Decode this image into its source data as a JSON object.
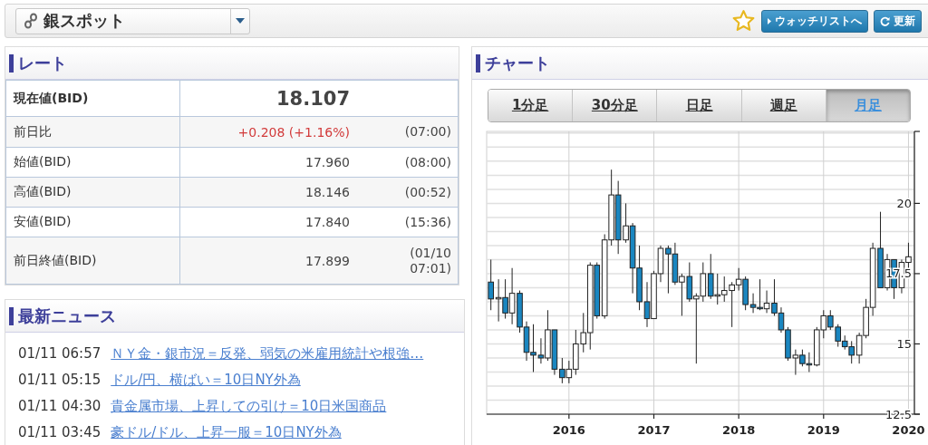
{
  "header": {
    "instrument": "銀スポット",
    "favorite": false,
    "watchlist_button": "ウォッチリストへ",
    "refresh_button": "更新"
  },
  "rate": {
    "title": "レート",
    "rows": [
      {
        "kind": "main",
        "label": "現在値(BID)",
        "value": "18.107"
      },
      {
        "kind": "change",
        "label": "前日比",
        "value": "+0.208 (+1.16%)",
        "time": "(07:00)"
      },
      {
        "kind": "plain",
        "label": "始値(BID)",
        "value": "17.960",
        "time": "(08:00)"
      },
      {
        "kind": "plain",
        "label": "高値(BID)",
        "value": "18.146",
        "time": "(00:52)"
      },
      {
        "kind": "plain",
        "label": "安値(BID)",
        "value": "17.840",
        "time": "(15:36)"
      },
      {
        "kind": "plain",
        "label": "前日終値(BID)",
        "value": "17.899",
        "time": "(01/10 07:01)"
      }
    ]
  },
  "news": {
    "title": "最新ニュース",
    "items": [
      {
        "time": "01/11 06:57",
        "headline": "ＮＹ金・銀市況＝反発、弱気の米雇用統計や根強…"
      },
      {
        "time": "01/11 05:15",
        "headline": "ドル/円、横ばい＝10日NY外為"
      },
      {
        "time": "01/11 04:30",
        "headline": "貴金属市場、上昇しての引け＝10日米国商品"
      },
      {
        "time": "01/11 03:45",
        "headline": "豪ドル/ドル、上昇一服＝10日NY外為"
      }
    ]
  },
  "chart": {
    "title": "チャート",
    "tabs": [
      {
        "label": "1分足",
        "selected": false
      },
      {
        "label": "30分足",
        "selected": false
      },
      {
        "label": "日足",
        "selected": false
      },
      {
        "label": "週足",
        "selected": false
      },
      {
        "label": "月足",
        "selected": true
      }
    ],
    "chart_data": {
      "type": "candlestick",
      "xlim": [
        2015.03,
        2020.07
      ],
      "ylim": [
        12.5,
        22.56
      ],
      "xticks": [
        {
          "value": 2016,
          "label": "2016"
        },
        {
          "value": 2017,
          "label": "2017"
        },
        {
          "value": 2018,
          "label": "2018"
        },
        {
          "value": 2019,
          "label": "2019"
        },
        {
          "value": 2020,
          "label": "2020"
        }
      ],
      "yticks": [
        12.5,
        15,
        17.5,
        20
      ],
      "grid": true,
      "x": [
        2015.08,
        2015.17,
        2015.25,
        2015.33,
        2015.42,
        2015.5,
        2015.58,
        2015.67,
        2015.75,
        2015.83,
        2015.92,
        2016.0,
        2016.08,
        2016.17,
        2016.25,
        2016.33,
        2016.42,
        2016.5,
        2016.58,
        2016.67,
        2016.75,
        2016.83,
        2016.92,
        2017.0,
        2017.08,
        2017.17,
        2017.25,
        2017.33,
        2017.42,
        2017.5,
        2017.58,
        2017.67,
        2017.75,
        2017.83,
        2017.92,
        2018.0,
        2018.08,
        2018.17,
        2018.25,
        2018.33,
        2018.42,
        2018.5,
        2018.58,
        2018.67,
        2018.75,
        2018.83,
        2018.92,
        2019.0,
        2019.08,
        2019.17,
        2019.25,
        2019.33,
        2019.42,
        2019.5,
        2019.58,
        2019.67,
        2019.75,
        2019.83,
        2019.92,
        2020.0
      ],
      "ohlc": [
        [
          17.2,
          18.0,
          16.2,
          16.6
        ],
        [
          16.6,
          17.3,
          15.8,
          16.65
        ],
        [
          16.65,
          17.3,
          15.9,
          16.1
        ],
        [
          16.1,
          17.7,
          15.7,
          16.8
        ],
        [
          16.8,
          16.9,
          15.4,
          15.6
        ],
        [
          15.6,
          15.8,
          14.4,
          14.7
        ],
        [
          14.7,
          15.7,
          14.0,
          14.6
        ],
        [
          14.6,
          15.2,
          14.3,
          14.5
        ],
        [
          14.5,
          16.2,
          14.4,
          15.5
        ],
        [
          15.5,
          15.5,
          13.9,
          14.1
        ],
        [
          14.1,
          14.5,
          13.6,
          13.8
        ],
        [
          13.8,
          14.4,
          13.6,
          14.1
        ],
        [
          14.1,
          15.5,
          13.9,
          15.0
        ],
        [
          15.0,
          16.1,
          14.7,
          15.4
        ],
        [
          15.4,
          17.9,
          14.8,
          17.8
        ],
        [
          17.8,
          17.9,
          15.9,
          16.0
        ],
        [
          16.0,
          18.9,
          15.9,
          18.7
        ],
        [
          18.7,
          21.2,
          18.5,
          20.3
        ],
        [
          20.3,
          20.8,
          18.2,
          18.7
        ],
        [
          18.7,
          20.0,
          18.6,
          19.2
        ],
        [
          19.2,
          19.3,
          16.8,
          17.7
        ],
        [
          17.7,
          18.5,
          16.2,
          16.5
        ],
        [
          16.5,
          17.2,
          15.6,
          15.9
        ],
        [
          15.9,
          17.6,
          15.9,
          17.5
        ],
        [
          17.5,
          18.5,
          17.2,
          18.4
        ],
        [
          18.4,
          18.5,
          16.8,
          18.2
        ],
        [
          18.2,
          18.6,
          17.1,
          17.2
        ],
        [
          17.2,
          17.5,
          16.0,
          17.4
        ],
        [
          17.4,
          17.9,
          16.5,
          16.6
        ],
        [
          16.6,
          16.8,
          14.3,
          16.7
        ],
        [
          16.7,
          17.9,
          16.5,
          17.5
        ],
        [
          17.5,
          18.2,
          16.6,
          16.7
        ],
        [
          16.7,
          17.5,
          16.4,
          16.75
        ],
        [
          16.75,
          17.4,
          16.5,
          16.9
        ],
        [
          16.9,
          17.2,
          15.6,
          17.1
        ],
        [
          17.1,
          17.7,
          16.9,
          17.3
        ],
        [
          17.3,
          17.4,
          16.2,
          16.4
        ],
        [
          16.4,
          16.8,
          16.1,
          16.3
        ],
        [
          16.3,
          17.3,
          16.2,
          16.25
        ],
        [
          16.25,
          16.9,
          16.1,
          16.45
        ],
        [
          16.45,
          17.3,
          16.0,
          16.1
        ],
        [
          16.1,
          16.3,
          15.4,
          15.5
        ],
        [
          15.5,
          15.6,
          14.4,
          14.5
        ],
        [
          14.5,
          14.8,
          13.9,
          14.6
        ],
        [
          14.6,
          14.8,
          14.2,
          14.3
        ],
        [
          14.3,
          14.7,
          14.0,
          14.25
        ],
        [
          14.25,
          15.6,
          14.2,
          15.5
        ],
        [
          15.5,
          16.2,
          15.2,
          16.0
        ],
        [
          16.0,
          16.2,
          15.5,
          15.6
        ],
        [
          15.6,
          15.7,
          14.9,
          15.1
        ],
        [
          15.1,
          15.3,
          14.8,
          14.9
        ],
        [
          14.9,
          15.1,
          14.3,
          14.6
        ],
        [
          14.6,
          15.4,
          14.3,
          15.3
        ],
        [
          15.3,
          16.6,
          15.2,
          16.3
        ],
        [
          16.3,
          18.6,
          16.0,
          18.4
        ],
        [
          18.4,
          19.7,
          17.0,
          17.0
        ],
        [
          17.0,
          18.2,
          16.9,
          18.0
        ],
        [
          18.0,
          18.0,
          16.6,
          17.0
        ],
        [
          17.0,
          18.0,
          16.8,
          17.9
        ],
        [
          17.9,
          18.6,
          17.5,
          18.1
        ]
      ]
    }
  }
}
